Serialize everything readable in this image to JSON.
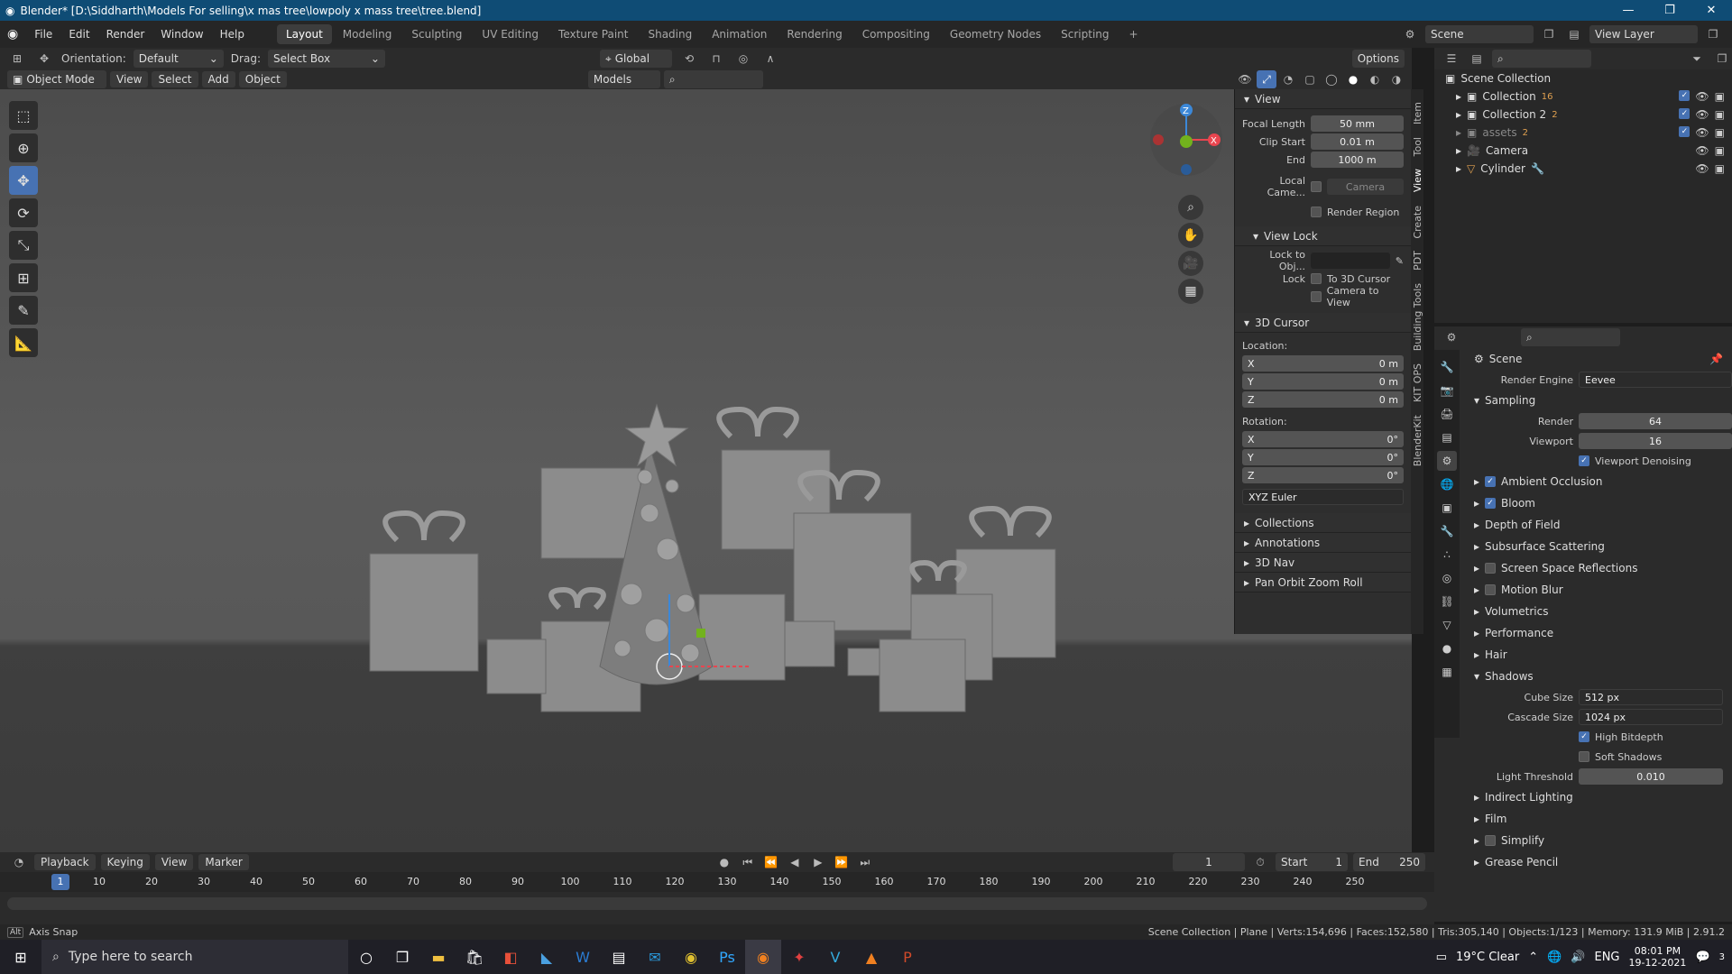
{
  "window": {
    "title": "Blender* [D:\\Siddharth\\Models For selling\\x mas tree\\lowpoly x mass tree\\tree.blend]",
    "controls": [
      "—",
      "❐",
      "✕"
    ]
  },
  "menubar": {
    "menus": [
      "File",
      "Edit",
      "Render",
      "Window",
      "Help"
    ],
    "workspaces": [
      "Layout",
      "Modeling",
      "Sculpting",
      "UV Editing",
      "Texture Paint",
      "Shading",
      "Animation",
      "Rendering",
      "Compositing",
      "Geometry Nodes",
      "Scripting"
    ],
    "active_workspace": "Layout",
    "scene": "Scene",
    "view_layer": "View Layer"
  },
  "tool_header": {
    "orientation_label": "Orientation:",
    "orientation_value": "Default",
    "drag_label": "Drag:",
    "drag_value": "Select Box",
    "transform_orientation": "Global",
    "options": "Options"
  },
  "view_header": {
    "mode": "Object Mode",
    "menus": [
      "View",
      "Select",
      "Add",
      "Object"
    ],
    "models_dropdown": "Models"
  },
  "npanel": {
    "view_section": "View",
    "focal_length_label": "Focal Length",
    "focal_length": "50 mm",
    "clip_start_label": "Clip Start",
    "clip_start": "0.01 m",
    "end_label": "End",
    "end": "1000 m",
    "local_camera_label": "Local Came...",
    "local_camera_value": "Camera",
    "render_region": "Render Region",
    "view_lock_section": "View Lock",
    "lock_to_obj_label": "Lock to Obj...",
    "lock_label": "Lock",
    "to_3d_cursor": "To 3D Cursor",
    "camera_to_view": "Camera to View",
    "cursor_section": "3D Cursor",
    "location_label": "Location:",
    "location": [
      {
        "axis": "X",
        "value": "0 m"
      },
      {
        "axis": "Y",
        "value": "0 m"
      },
      {
        "axis": "Z",
        "value": "0 m"
      }
    ],
    "rotation_label": "Rotation:",
    "rotation": [
      {
        "axis": "X",
        "value": "0°"
      },
      {
        "axis": "Y",
        "value": "0°"
      },
      {
        "axis": "Z",
        "value": "0°"
      }
    ],
    "rotation_mode": "XYZ Euler",
    "collapsed_sections": [
      "Collections",
      "Annotations",
      "3D Nav",
      "Pan Orbit Zoom Roll"
    ],
    "tabs": [
      "Item",
      "Tool",
      "View",
      "Create",
      "PDT",
      "Building Tools",
      "KIT OPS",
      "BlenderKit"
    ]
  },
  "outliner": {
    "root": "Scene Collection",
    "items": [
      {
        "name": "Collection",
        "badge": "16",
        "checked": true
      },
      {
        "name": "Collection 2",
        "badge": "2",
        "checked": true
      },
      {
        "name": "assets",
        "badge": "2",
        "checked": true
      },
      {
        "name": "Camera",
        "badge": "",
        "checked": false
      },
      {
        "name": "Cylinder",
        "badge": "",
        "checked": false
      }
    ]
  },
  "properties": {
    "context": "Scene",
    "render_engine_label": "Render Engine",
    "render_engine": "Eevee",
    "sampling": "Sampling",
    "render_label": "Render",
    "render_samples": "64",
    "viewport_label": "Viewport",
    "viewport_samples": "16",
    "viewport_denoising": "Viewport Denoising",
    "sections": [
      {
        "name": "Ambient Occlusion",
        "checkbox": true,
        "checked": true
      },
      {
        "name": "Bloom",
        "checkbox": true,
        "checked": true
      },
      {
        "name": "Depth of Field",
        "checkbox": false,
        "checked": false
      },
      {
        "name": "Subsurface Scattering",
        "checkbox": false,
        "checked": false
      },
      {
        "name": "Screen Space Reflections",
        "checkbox": true,
        "checked": false
      },
      {
        "name": "Motion Blur",
        "checkbox": true,
        "checked": false
      },
      {
        "name": "Volumetrics",
        "checkbox": false,
        "checked": false
      },
      {
        "name": "Performance",
        "checkbox": false,
        "checked": false
      },
      {
        "name": "Hair",
        "checkbox": false,
        "checked": false
      }
    ],
    "shadows": "Shadows",
    "cube_size_label": "Cube Size",
    "cube_size": "512 px",
    "cascade_size_label": "Cascade Size",
    "cascade_size": "1024 px",
    "high_bitdepth": "High Bitdepth",
    "soft_shadows": "Soft Shadows",
    "light_threshold_label": "Light Threshold",
    "light_threshold": "0.010",
    "after_sections": [
      {
        "name": "Indirect Lighting",
        "checkbox": false
      },
      {
        "name": "Film",
        "checkbox": false
      },
      {
        "name": "Simplify",
        "checkbox": true
      },
      {
        "name": "Grease Pencil",
        "checkbox": false
      }
    ]
  },
  "timeline": {
    "menus": [
      "Playback",
      "Keying",
      "View",
      "Marker"
    ],
    "current_frame": "1",
    "start_label": "Start",
    "start": "1",
    "end_label": "End",
    "end": "250",
    "ticks": [
      "10",
      "20",
      "30",
      "40",
      "50",
      "60",
      "70",
      "80",
      "90",
      "100",
      "110",
      "120",
      "130",
      "140",
      "150",
      "160",
      "170",
      "180",
      "190",
      "200",
      "210",
      "220",
      "230",
      "240",
      "250"
    ]
  },
  "statusbar": {
    "left": "Axis Snap",
    "right": "Scene Collection | Plane | Verts:154,696 | Faces:152,580 | Tris:305,140 | Objects:1/123 | Memory: 131.9 MiB | 2.91.2"
  },
  "taskbar": {
    "search": "Type here to search",
    "weather": "19°C  Clear",
    "lang": "ENG",
    "time": "08:01 PM",
    "date": "19-12-2021",
    "notif": "3"
  },
  "colors": {
    "accent": "#4772b3",
    "titlebar": "#0f4c75",
    "axis_x": "#e8454f",
    "axis_y": "#72b21d",
    "axis_z": "#3c88d8"
  }
}
